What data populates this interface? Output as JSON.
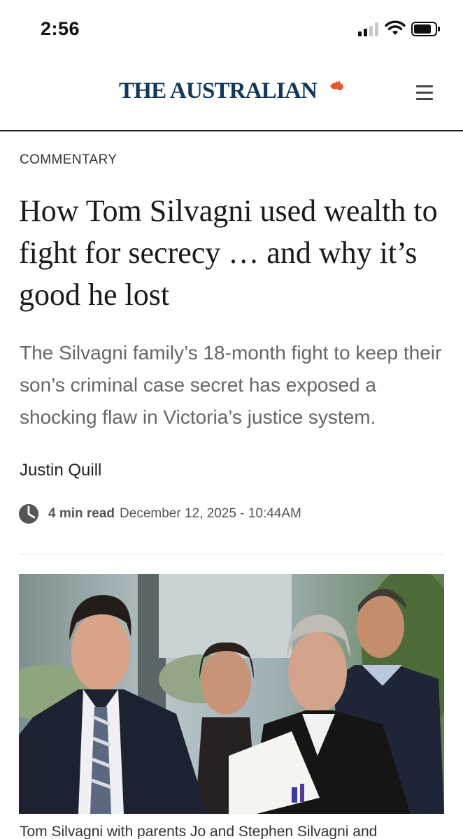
{
  "status_bar": {
    "time": "2:56"
  },
  "masthead": {
    "logo_text": "THE AUSTRALIAN",
    "logo_color": "#11385c",
    "accent_color": "#e4572e",
    "menu_icon": "hamburger-menu-icon"
  },
  "article": {
    "kicker": "COMMENTARY",
    "headline": "How Tom Silvagni used wealth to fight for secrecy … and why it’s good he lost",
    "standfirst": "The Silvagni family’s 18-month fight to keep their son’s criminal case secret has exposed a shocking flaw in Victoria’s justice system.",
    "author": "Justin Quill",
    "read_time": "4 min read",
    "published": "December 12, 2025 - 10:44AM",
    "clock_icon": "clock-icon",
    "caption": "Tom Silvagni with parents Jo and Stephen Silvagni and"
  }
}
